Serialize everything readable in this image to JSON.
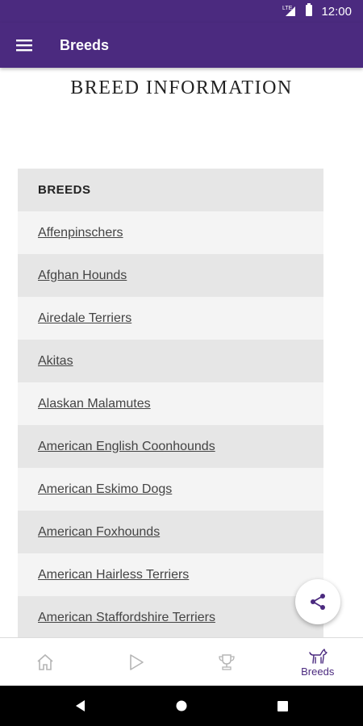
{
  "status_bar": {
    "time": "12:00",
    "network_label": "LTE"
  },
  "app_bar": {
    "title": "Breeds",
    "menu_icon": "menu-icon"
  },
  "page": {
    "heading": "BREED INFORMATION"
  },
  "breeds_table": {
    "header": "BREEDS",
    "items": [
      "Affenpinschers",
      "Afghan Hounds",
      "Airedale Terriers",
      "Akitas",
      "Alaskan Malamutes",
      "American English Coonhounds",
      "American Eskimo Dogs",
      "American Foxhounds",
      "American Hairless Terriers",
      "American Staffordshire Terriers"
    ]
  },
  "fab": {
    "icon": "share-icon"
  },
  "bottom_nav": {
    "items": [
      {
        "icon": "home-icon",
        "label": ""
      },
      {
        "icon": "play-icon",
        "label": ""
      },
      {
        "icon": "trophy-icon",
        "label": ""
      },
      {
        "icon": "dog-icon",
        "label": "Breeds"
      }
    ],
    "selected_index": 3
  },
  "colors": {
    "primary": "#4b2a7f",
    "row_light": "#f4f4f4",
    "row_dark": "#e6e6e6",
    "inactive_icon": "#b5b5b5"
  }
}
